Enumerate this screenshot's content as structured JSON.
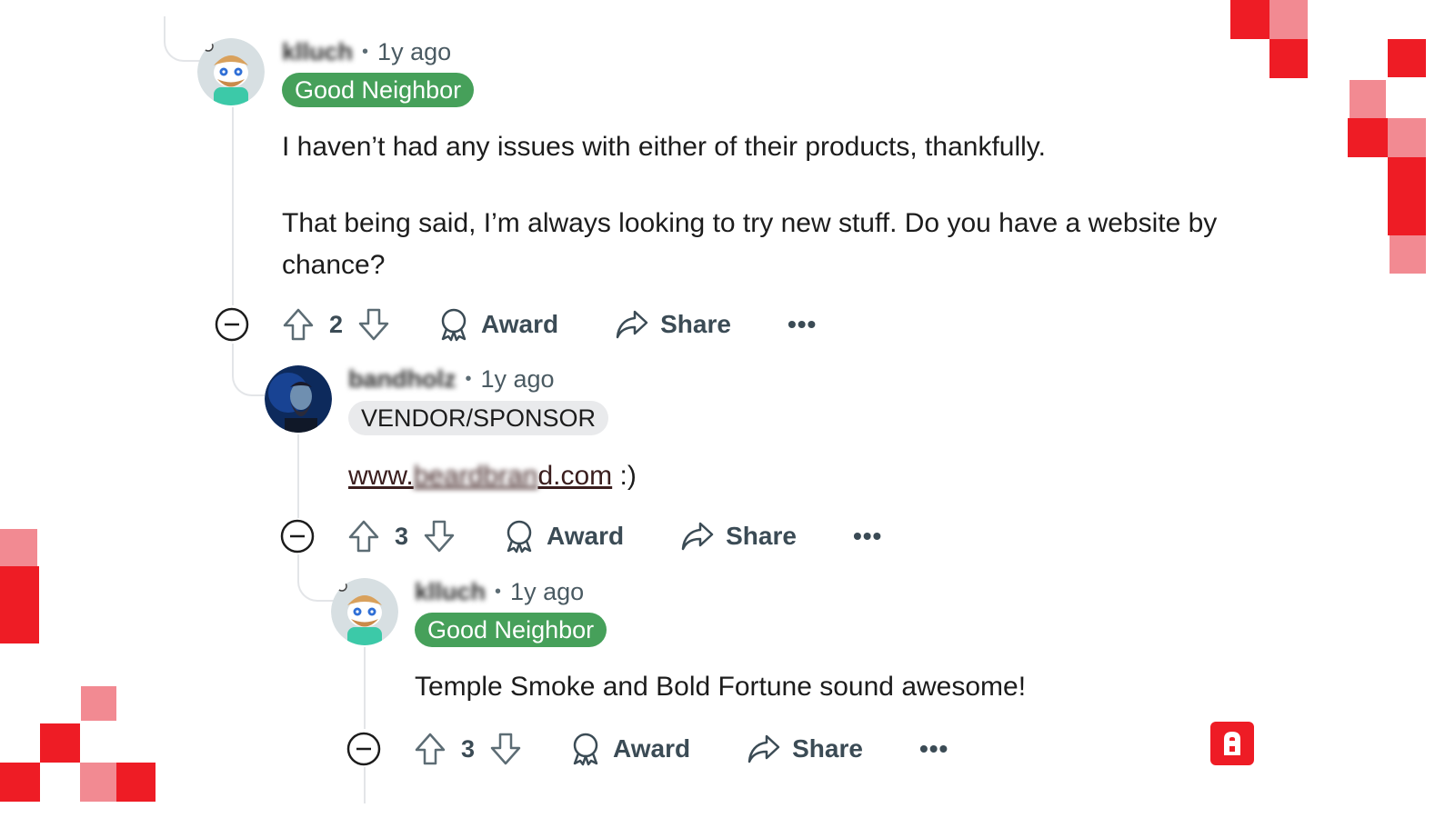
{
  "comments": [
    {
      "username": "klluch",
      "time": "1y ago",
      "flair": "Good Neighbor",
      "body": [
        "I haven’t had any issues with either of their products, thankfully.",
        "That being said, I’m always looking to try new stuff. Do you have a website by chance?"
      ],
      "score": "2",
      "award_label": "Award",
      "share_label": "Share",
      "more_label": "•••"
    },
    {
      "username": "bandholz",
      "time": "1y ago",
      "flair": "VENDOR/SPONSOR",
      "link_prefix": "www.",
      "link_blurred": "beardbran",
      "link_suffix": "d.com",
      "link_after": " :)",
      "score": "3",
      "award_label": "Award",
      "share_label": "Share",
      "more_label": "•••"
    },
    {
      "username": "klluch",
      "time": "1y ago",
      "flair": "Good Neighbor",
      "body": [
        "Temple Smoke and Bold Fortune sound awesome!"
      ],
      "score": "3",
      "award_label": "Award",
      "share_label": "Share",
      "more_label": "•••"
    }
  ],
  "colors": {
    "accent_red": "#ee1c25",
    "accent_pink": "#f28a92",
    "flair_green": "#46a05a",
    "flair_gray": "#e9eaec"
  },
  "icons": [
    "collapse-icon",
    "upvote-icon",
    "downvote-icon",
    "award-icon",
    "share-icon",
    "brand-logo-icon"
  ]
}
